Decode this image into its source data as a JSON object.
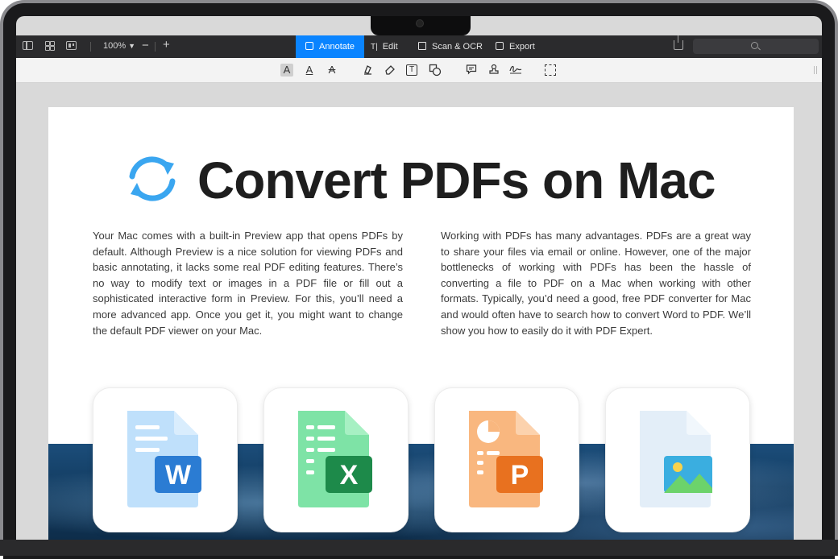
{
  "toolbar": {
    "zoom_label": "100%",
    "zoom_minus": "−",
    "zoom_plus": "+",
    "tabs": [
      {
        "label": "Annotate",
        "active": true
      },
      {
        "label": "Edit",
        "active": false
      },
      {
        "label": "Scan & OCR",
        "active": false
      },
      {
        "label": "Export",
        "active": false
      }
    ],
    "accent_color": "#0a84ff"
  },
  "annotate_tools": [
    {
      "icon": "text-highlight-icon",
      "glyph": "A"
    },
    {
      "icon": "text-underline-icon",
      "glyph": "A"
    },
    {
      "icon": "text-strikethrough-icon",
      "glyph": "A"
    },
    {
      "icon": "highlighter-pen-icon"
    },
    {
      "icon": "eraser-icon"
    },
    {
      "icon": "text-box-icon",
      "glyph": "T"
    },
    {
      "icon": "shapes-icon"
    },
    {
      "icon": "comment-icon"
    },
    {
      "icon": "stamp-icon"
    },
    {
      "icon": "signature-icon"
    },
    {
      "icon": "area-select-icon"
    }
  ],
  "document": {
    "title": "Convert PDFs on Mac",
    "paragraph_left": "Your Mac comes with a built-in Preview app that opens PDFs by default. Although Preview is a nice solution for viewing PDFs and basic annotating, it lacks some real PDF editing features. There’s no way to modify text or images in a PDF file or fill out a sophisticated interactive form in Preview. For this, you’ll need a more advanced app. Once you get it, you might want to change the default PDF viewer on your Mac.",
    "paragraph_right": "Working with PDFs has many advantages. PDFs are a great way to share your files via email or online. However, one of the major bottlenecks of working with PDFs has been the hassle of converting a file to PDF on a Mac when working with other formats. Typically, you’d need a good, free PDF converter for Mac and would often have to search how to convert Word to PDF. We’ll show you how to easily do it with PDF Expert.",
    "file_cards": [
      {
        "icon": "word-file-icon",
        "badge": "W",
        "color": "#2b7cd3"
      },
      {
        "icon": "excel-file-icon",
        "badge": "X",
        "color": "#1d8a4a"
      },
      {
        "icon": "powerpoint-file-icon",
        "badge": "P",
        "color": "#e8711f"
      },
      {
        "icon": "image-file-icon",
        "badge": "",
        "color": "#3aaee0"
      }
    ]
  }
}
